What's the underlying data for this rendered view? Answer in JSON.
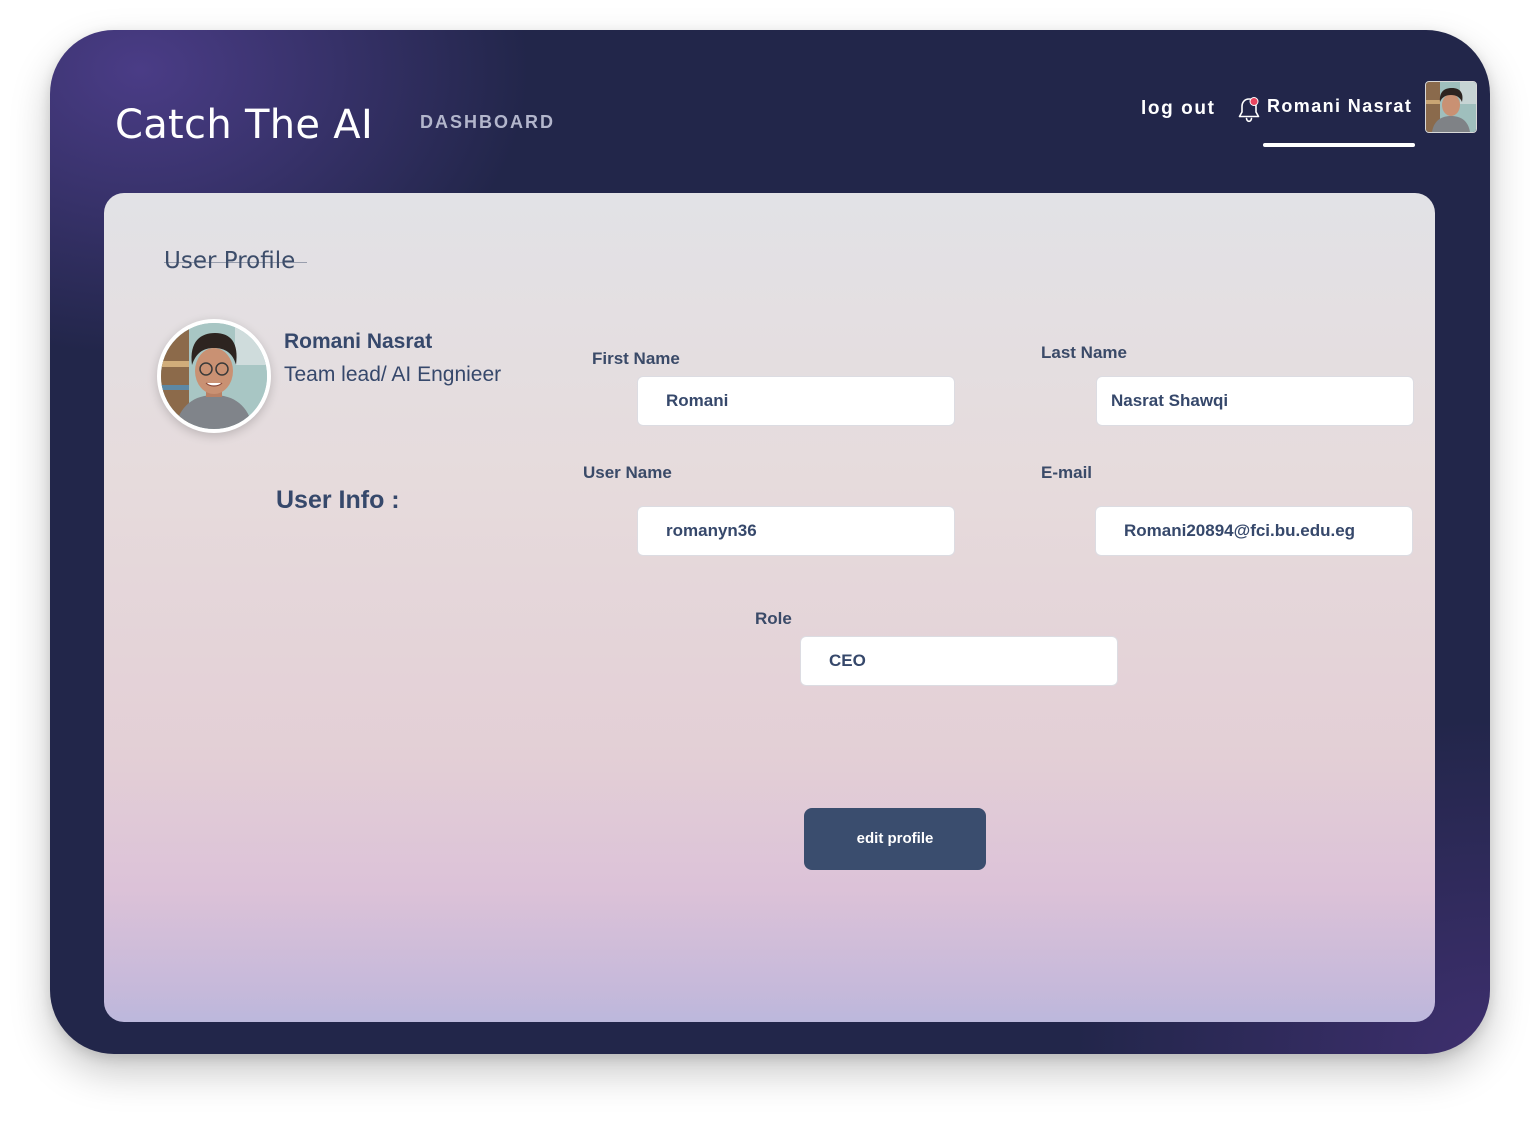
{
  "header": {
    "brand": "Catch The AI",
    "nav": {
      "dashboard": "DASHBOARD"
    },
    "logout": "log out",
    "user_name": "Romani Nasrat",
    "icons": {
      "notification": "bell-icon",
      "avatar": "user-avatar"
    },
    "notification_dot_color": "#e8455f"
  },
  "profile": {
    "title": "User Profile",
    "name": "Romani Nasrat",
    "role": "Team lead/ AI Engnieer",
    "user_info_heading": "User Info :"
  },
  "form": {
    "first_name": {
      "label": "First Name",
      "value": "Romani"
    },
    "last_name": {
      "label": "Last Name",
      "value": "Nasrat Shawqi"
    },
    "user_name": {
      "label": "User Name",
      "value": "romanyn36"
    },
    "email": {
      "label": "E-mail",
      "value": "Romani20894@fci.bu.edu.eg"
    },
    "role": {
      "label": "Role",
      "value": "CEO"
    }
  },
  "actions": {
    "edit_profile": "edit profile"
  },
  "colors": {
    "background_dark": "#22264a",
    "accent_purple": "#4a3c86",
    "text_primary": "#36486b",
    "button": "#3a4d6e"
  }
}
